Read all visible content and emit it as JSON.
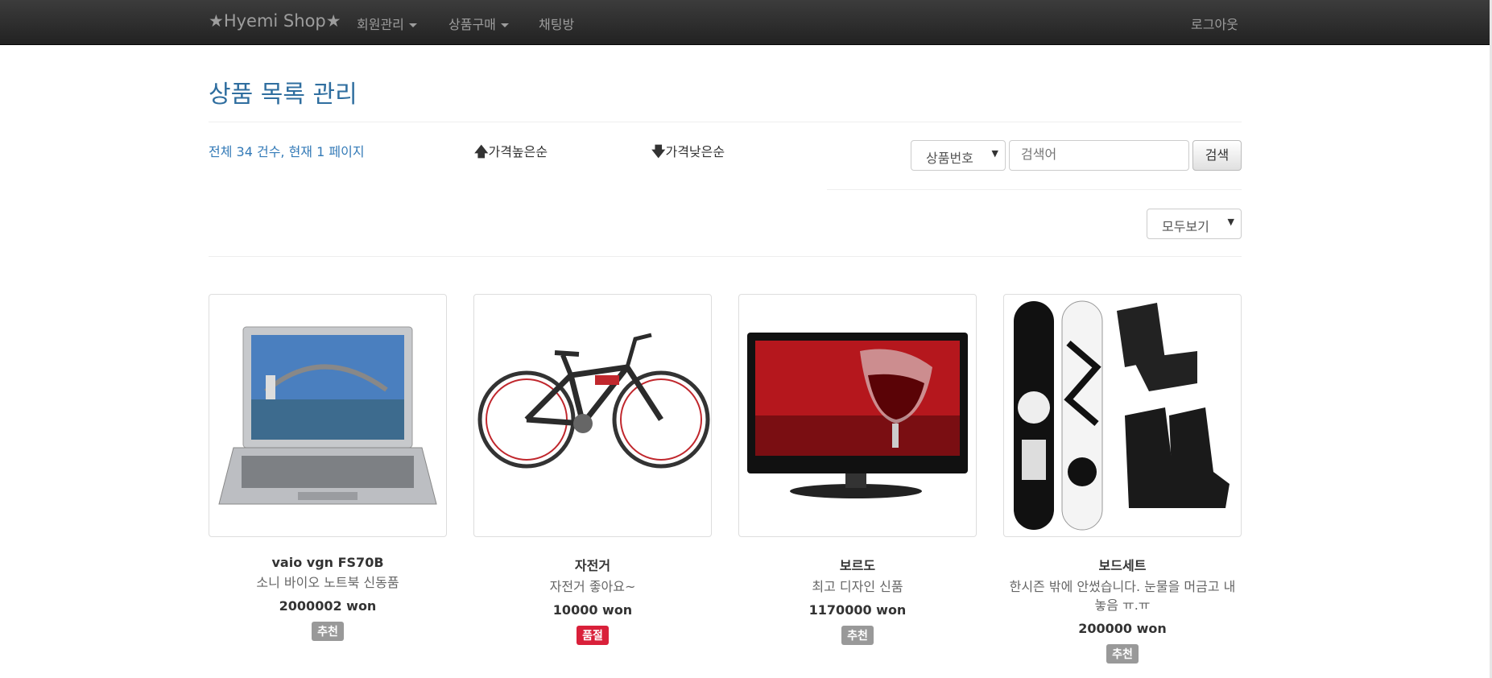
{
  "navbar": {
    "brand": "★Hyemi Shop★",
    "menu": [
      "회원관리",
      "상품구매",
      "채팅방"
    ],
    "logout": "로그아웃"
  },
  "page_title": "상품 목록 관리",
  "summary": "전체 34 건수, 현재 1 페이지",
  "sort": {
    "high_arrow": "🡅",
    "high_label": "가격높은순",
    "low_arrow": "🡇",
    "low_label": "가격낮은순"
  },
  "search": {
    "condition_selected": "상품번호",
    "placeholder": "검색어",
    "button_label": "검색"
  },
  "view_filter": {
    "selected": "모두보기"
  },
  "products": [
    {
      "name": "vaio vgn FS70B",
      "desc": "소니 바이오 노트북 신동품",
      "price": "2000002 won",
      "badge": "추천",
      "badge_color": "#999999",
      "image": "laptop"
    },
    {
      "name": "자전거",
      "desc": "자전거 좋아요~",
      "price": "10000 won",
      "badge": "품절",
      "badge_color": "#d9203a",
      "image": "bicycle"
    },
    {
      "name": "보르도",
      "desc": "최고 디자인 신품",
      "price": "1170000 won",
      "badge": "추천",
      "badge_color": "#999999",
      "image": "tv"
    },
    {
      "name": "보드세트",
      "desc": "한시즌 밖에 안썼습니다. 눈물을 머금고 내놓음 ㅠ.ㅠ",
      "price": "200000 won",
      "badge": "추천",
      "badge_color": "#999999",
      "image": "snowboard-set"
    }
  ],
  "colors": {
    "accent": "#337ab7",
    "title": "#2f6e9f",
    "navbar": "#222222"
  }
}
